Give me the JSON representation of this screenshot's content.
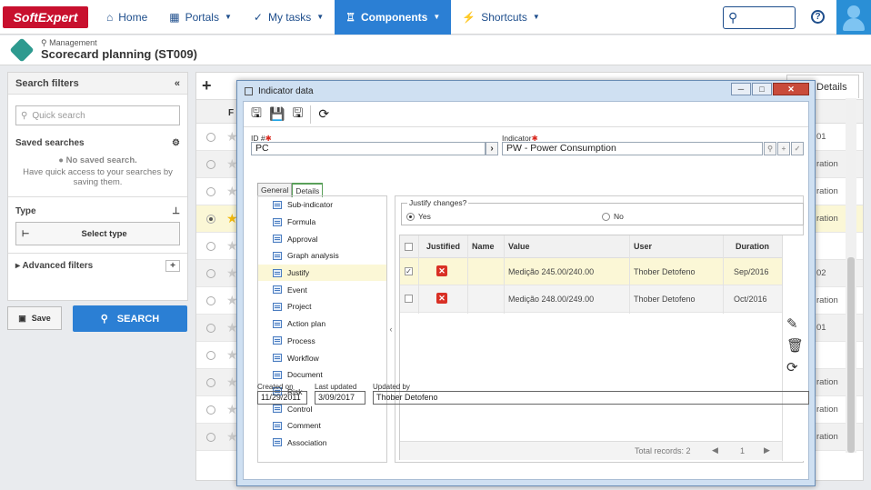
{
  "topbar": {
    "logo": "SoftExpert",
    "nav": [
      {
        "label": "Home",
        "icon": "home-icon",
        "active": false
      },
      {
        "label": "Portals",
        "icon": "grid-icon",
        "active": false,
        "caret": true
      },
      {
        "label": "My tasks",
        "icon": "check-icon",
        "active": false,
        "caret": true
      },
      {
        "label": "Components",
        "icon": "trophy-icon",
        "active": true,
        "caret": true
      },
      {
        "label": "Shortcuts",
        "icon": "lightning-icon",
        "active": false,
        "caret": true
      }
    ],
    "help": "?"
  },
  "subheader": {
    "crumb": "Management",
    "title": "Scorecard planning (ST009)"
  },
  "left_panel": {
    "title": "Search filters",
    "quick_search_placeholder": "Quick search",
    "saved_searches": "Saved searches",
    "no_saved": "No saved search.",
    "no_saved_hint": "Have quick access to your searches by saving them.",
    "type": "Type",
    "select_type": "Select type",
    "advanced": "Advanced filters",
    "save": "Save",
    "search": "SEARCH"
  },
  "grid": {
    "header_letter": "F",
    "details_tab": "Details",
    "rows": [
      {
        "tail": "01",
        "radio": false,
        "star": false,
        "style": "plain"
      },
      {
        "tail": "ration",
        "radio": false,
        "star": false,
        "style": "alt"
      },
      {
        "tail": "ration",
        "radio": false,
        "star": false,
        "style": "plain"
      },
      {
        "tail": "ration",
        "radio": true,
        "star": true,
        "style": "sel"
      },
      {
        "tail": "",
        "radio": false,
        "star": false,
        "style": "plain"
      },
      {
        "tail": "02",
        "radio": false,
        "star": false,
        "style": "alt"
      },
      {
        "tail": "ration",
        "radio": false,
        "star": false,
        "style": "plain"
      },
      {
        "tail": "01",
        "radio": false,
        "star": false,
        "style": "alt"
      },
      {
        "tail": "",
        "radio": false,
        "star": false,
        "style": "plain"
      },
      {
        "tail": "ration",
        "radio": false,
        "star": false,
        "style": "alt"
      },
      {
        "tail": "ration",
        "radio": false,
        "star": false,
        "style": "plain"
      },
      {
        "tail": "ration",
        "radio": false,
        "star": false,
        "style": "alt"
      }
    ]
  },
  "modal": {
    "title": "Indicator data",
    "id_label": "ID #",
    "id_value": "PC",
    "indicator_label": "Indicator",
    "indicator_value": "PW - Power Consumption",
    "tabs": [
      "General",
      "Details"
    ],
    "tree": [
      "Sub-indicator",
      "Formula",
      "Approval",
      "Graph analysis",
      "Justify",
      "Event",
      "Project",
      "Action plan",
      "Process",
      "Workflow",
      "Document",
      "Risk",
      "Control",
      "Comment",
      "Association"
    ],
    "tree_selected": "Justify",
    "justify_legend": "Justify changes?",
    "yes": "Yes",
    "no": "No",
    "columns": [
      "Justified",
      "Name",
      "Value",
      "User",
      "Duration"
    ],
    "rows": [
      {
        "checked": true,
        "value": "Medição 245.00/240.00",
        "user": "Thober Detofeno",
        "duration": "Sep/2016"
      },
      {
        "checked": false,
        "value": "Medição 248.00/249.00",
        "user": "Thober Detofeno",
        "duration": "Oct/2016"
      }
    ],
    "total_records": "Total records: 2",
    "page": "1",
    "created_on_label": "Created on",
    "created_on": "11/29/2011",
    "last_updated_label": "Last updated",
    "last_updated": "3/09/2017",
    "updated_by_label": "Updated by",
    "updated_by": "Thober Detofeno"
  }
}
